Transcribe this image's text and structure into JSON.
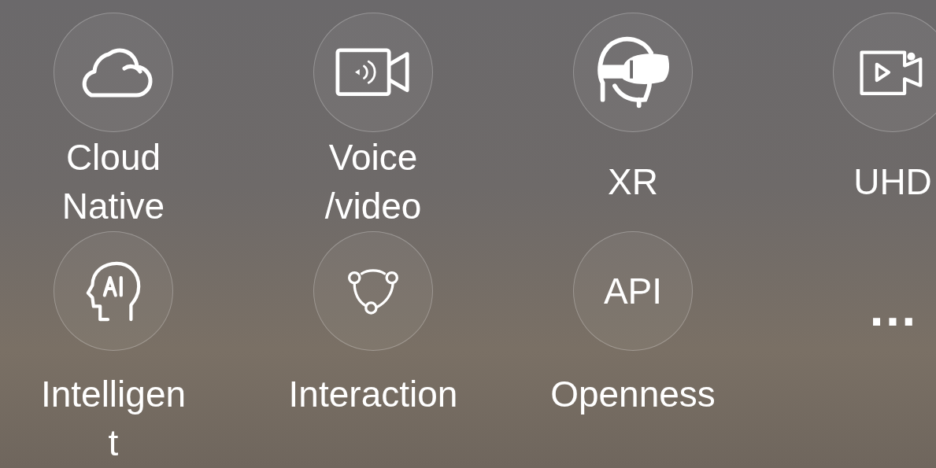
{
  "rows": [
    {
      "items": [
        {
          "kind": "icon",
          "label_lines": [
            "Cloud",
            "Native"
          ]
        },
        {
          "kind": "icon",
          "label_lines": [
            "Voice",
            "/video"
          ]
        },
        {
          "kind": "icon",
          "label_lines": [
            "XR"
          ]
        },
        {
          "kind": "icon",
          "label_lines": [
            "UHD"
          ]
        }
      ]
    },
    {
      "items": [
        {
          "kind": "icon",
          "label_lines": [
            "Intelligen",
            "t"
          ]
        },
        {
          "kind": "icon",
          "label_lines": [
            "Interaction"
          ]
        },
        {
          "kind": "text",
          "text": "API",
          "label_lines": [
            "Openness"
          ]
        },
        {
          "kind": "more",
          "text": "…"
        }
      ]
    }
  ]
}
